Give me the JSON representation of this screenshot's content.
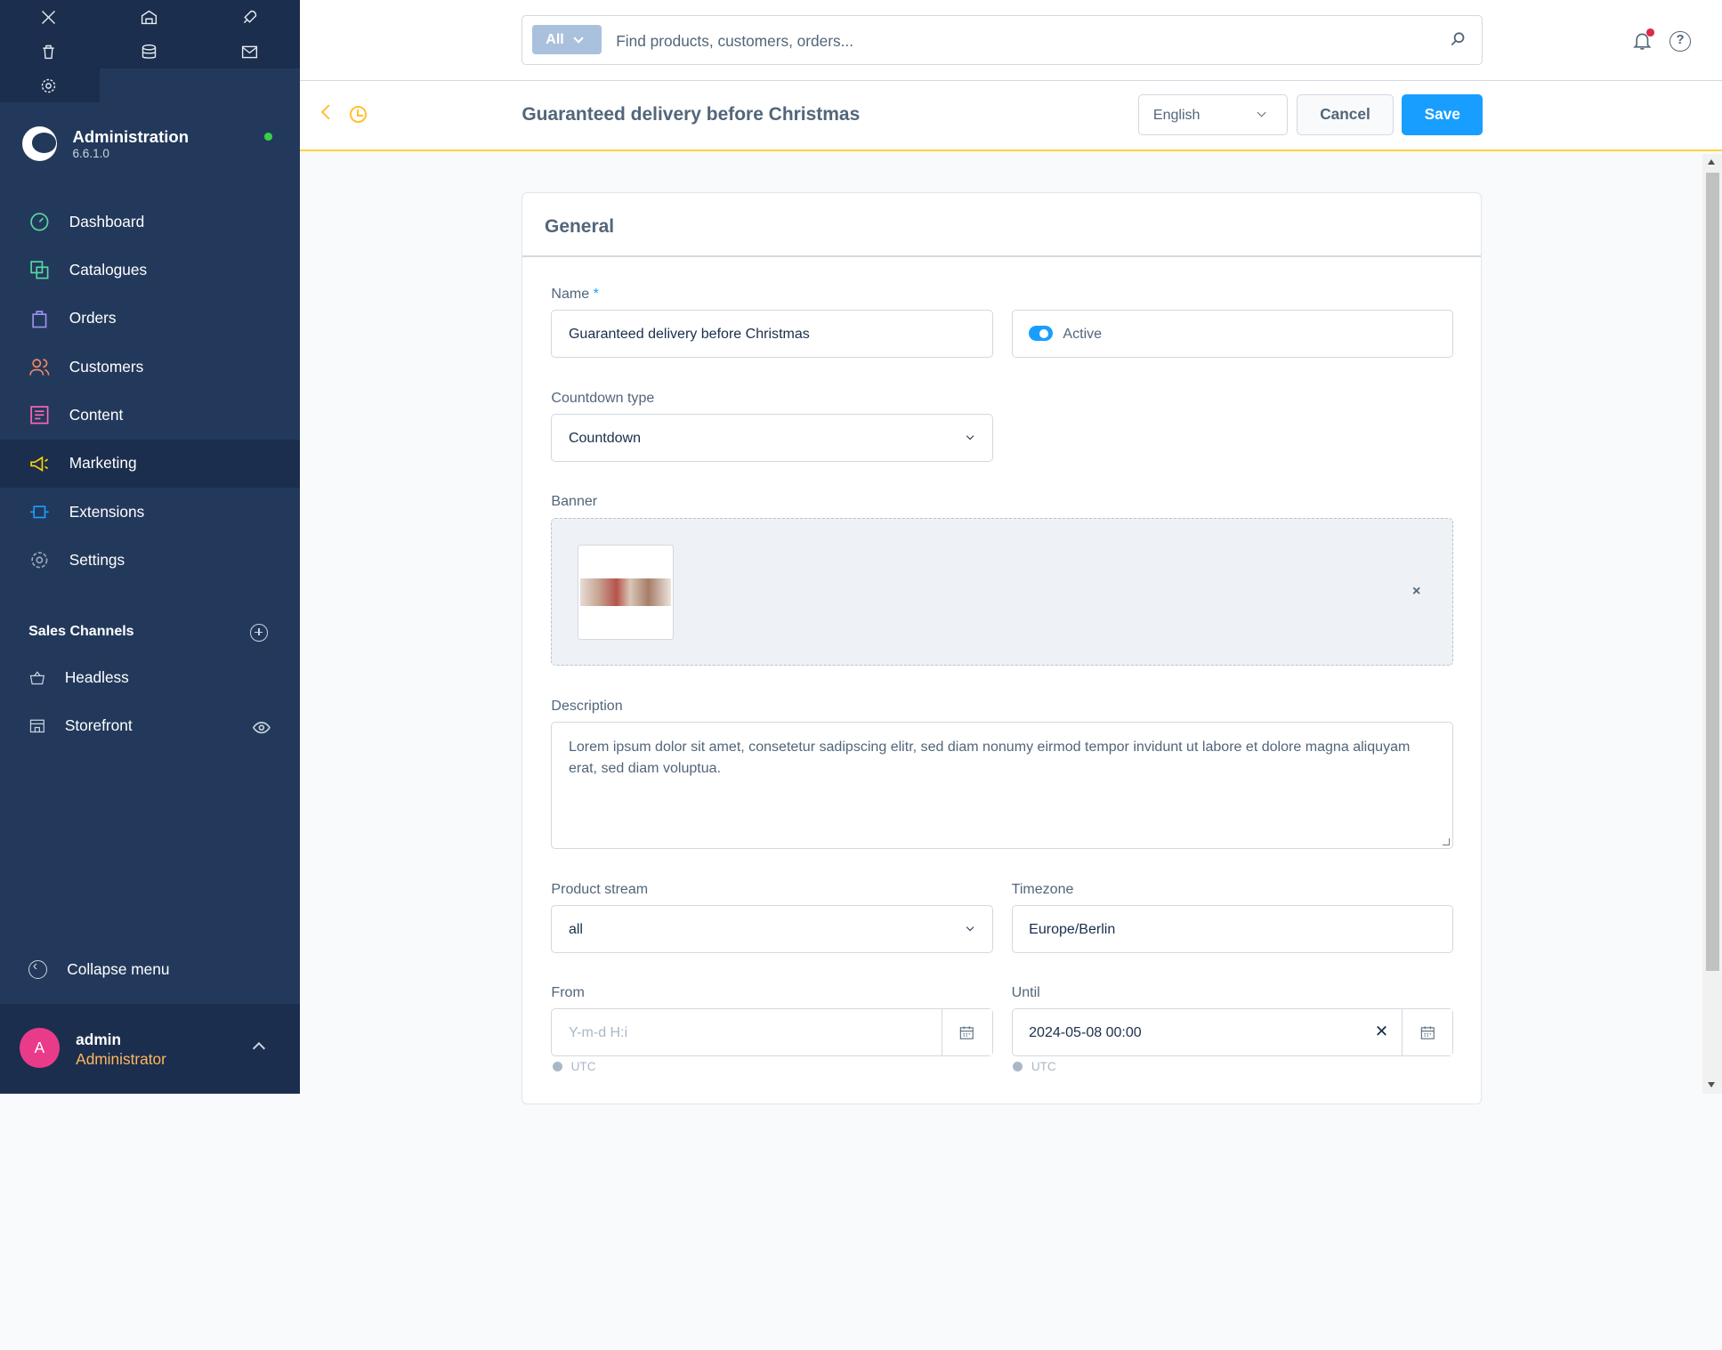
{
  "sidebar": {
    "brand_title": "Administration",
    "version": "6.6.1.0",
    "nav": [
      {
        "label": "Dashboard",
        "icon": "dashboard-icon",
        "color": "#57d9a3"
      },
      {
        "label": "Catalogues",
        "icon": "catalogue-icon",
        "color": "#57d9a3"
      },
      {
        "label": "Orders",
        "icon": "orders-icon",
        "color": "#a092f0"
      },
      {
        "label": "Customers",
        "icon": "customers-icon",
        "color": "#f88962"
      },
      {
        "label": "Content",
        "icon": "content-icon",
        "color": "#ff68b4"
      },
      {
        "label": "Marketing",
        "icon": "marketing-icon",
        "color": "#ffd700"
      },
      {
        "label": "Extensions",
        "icon": "extensions-icon",
        "color": "#189eff"
      },
      {
        "label": "Settings",
        "icon": "settings-icon",
        "color": "#9aa8b5"
      }
    ],
    "sales_channels_title": "Sales Channels",
    "sales_channels": [
      {
        "label": "Headless"
      },
      {
        "label": "Storefront"
      }
    ],
    "collapse_label": "Collapse menu",
    "user": {
      "initial": "A",
      "name": "admin",
      "role": "Administrator"
    }
  },
  "topbar": {
    "search_type": "All",
    "search_placeholder": "Find products, customers, orders..."
  },
  "smartbar": {
    "title": "Guaranteed delivery before Christmas",
    "language": "English",
    "cancel_label": "Cancel",
    "save_label": "Save"
  },
  "form": {
    "card_title": "General",
    "name_label": "Name",
    "name_required": "*",
    "name_value": "Guaranteed delivery before Christmas",
    "active_label": "Active",
    "active": true,
    "countdown_type_label": "Countdown type",
    "countdown_type_value": "Countdown",
    "banner_label": "Banner",
    "banner_remove": "×",
    "description_label": "Description",
    "description_value": "Lorem ipsum dolor sit amet, consetetur sadipscing elitr, sed diam nonumy eirmod tempor invidunt ut labore et dolore magna aliquyam erat, sed diam voluptua.",
    "product_stream_label": "Product stream",
    "product_stream_value": "all",
    "timezone_label": "Timezone",
    "timezone_value": "Europe/Berlin",
    "from_label": "From",
    "from_placeholder": "Y-m-d H:i",
    "until_label": "Until",
    "until_value": "2024-05-08 00:00",
    "from_tz": "UTC",
    "until_tz": "UTC"
  },
  "colors": {
    "sidebar_bg": "#23395b",
    "accent": "#189eff",
    "smartbar_border": "#ffd23f"
  }
}
